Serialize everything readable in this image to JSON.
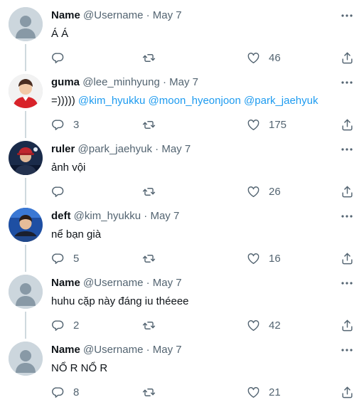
{
  "tweets": [
    {
      "name": "Name",
      "handle": "@Username",
      "separator": "·",
      "date": "May 7",
      "text": "Á Á",
      "mentions": [],
      "avatar": "default-avatar",
      "replies": "",
      "retweets": "",
      "likes": "46"
    },
    {
      "name": "guma",
      "handle": "@lee_minhyung",
      "separator": "·",
      "date": "May 7",
      "text": "=)))))",
      "mentions": [
        "@kim_hyukku",
        "@moon_hyeonjoon",
        "@park_jaehyuk"
      ],
      "avatar": "photo-red-jacket",
      "replies": "3",
      "retweets": "",
      "likes": "175"
    },
    {
      "name": "ruler",
      "handle": "@park_jaehyuk",
      "separator": "·",
      "date": "May 7",
      "text": "ảnh vội",
      "mentions": [],
      "avatar": "photo-dark-red-cap",
      "replies": "",
      "retweets": "",
      "likes": "26"
    },
    {
      "name": "deft",
      "handle": "@kim_hyukku",
      "separator": "·",
      "date": "May 7",
      "text": "nể bạn già",
      "mentions": [],
      "avatar": "photo-blue-stage",
      "replies": "5",
      "retweets": "",
      "likes": "16"
    },
    {
      "name": "Name",
      "handle": "@Username",
      "separator": "·",
      "date": "May 7",
      "text": "huhu cặp này đáng iu théeee",
      "mentions": [],
      "avatar": "default-avatar",
      "replies": "2",
      "retweets": "",
      "likes": "42"
    },
    {
      "name": "Name",
      "handle": "@Username",
      "separator": "·",
      "date": "May 7",
      "text": "NỔ R NỔ R",
      "mentions": [],
      "avatar": "default-avatar",
      "replies": "8",
      "retweets": "",
      "likes": "21"
    }
  ],
  "colors": {
    "text": "#0f1419",
    "secondary": "#536471",
    "mention": "#1d9bf0",
    "thread_line": "#cfd9de",
    "default_avatar_bg": "#ccd6dd"
  },
  "icons": {
    "reply": "reply-icon",
    "retweet": "retweet-icon",
    "like": "like-icon",
    "share": "share-icon",
    "more": "more-icon"
  }
}
